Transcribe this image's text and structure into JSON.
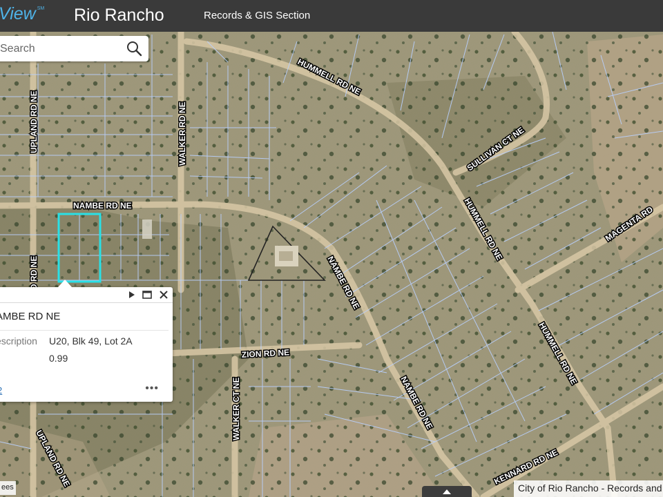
{
  "header": {
    "logo_text": "View",
    "logo_mark": "SM",
    "city": "Rio Rancho",
    "section": "Records & GIS Section"
  },
  "search": {
    "placeholder": "Search",
    "visible_text": "arch",
    "button_icon": "search-icon"
  },
  "popup": {
    "title": "AMBE RD NE",
    "rows": [
      {
        "label": "escription",
        "value": "U20, Blk 49, Lot 2A"
      },
      {
        "label": "",
        "value": "0.99"
      }
    ],
    "link_text": "2",
    "controls": [
      "play-icon",
      "maximize-icon",
      "close-icon"
    ],
    "more": "•••"
  },
  "roads": [
    "HUMMELL RD NE",
    "SULLIVAN CT NE",
    "HUMMELL RD NE",
    "HUMMELL RD NE",
    "MAGENTA RD",
    "UPLAND RD NE",
    "WALKER RD NE",
    "NAMBE RD NE",
    "NAMBE RD NE",
    "ZION RD NE",
    "WALKER CT NE",
    "NAMBE RD NE",
    "UPLAND RD NE",
    "KENNARD RD NE",
    "D RD NE"
  ],
  "attribution": "City of Rio Rancho - Records and",
  "attribution_left": "ees",
  "colors": {
    "header_bg": "#3a3a3a",
    "logo": "#4fb3e8",
    "parcel_line": "#b8d0ff",
    "selected_parcel": "#29e0e6"
  }
}
